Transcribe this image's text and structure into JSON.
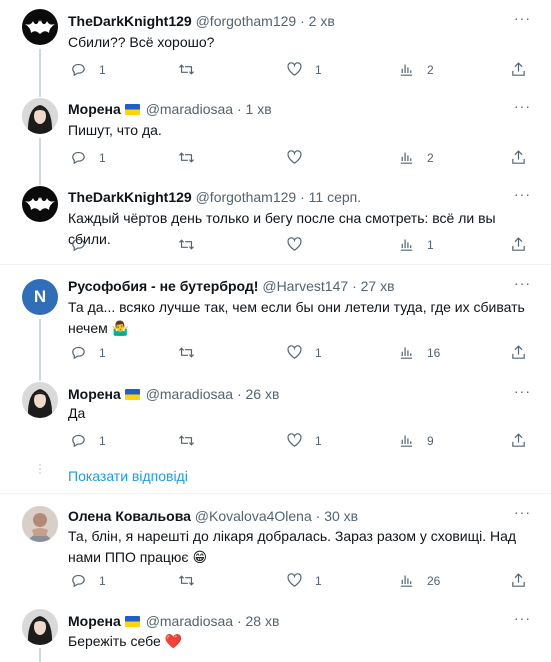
{
  "more_label": "···",
  "show_replies": "Показати відповіді",
  "tweets": [
    {
      "name": "TheDarkKnight129",
      "handle": "@forgotham129",
      "time": "2 хв",
      "text": "Сбили?? Всё хорошо?",
      "replies": "1",
      "retweets": "",
      "likes": "1",
      "views": "2"
    },
    {
      "name": "Морена",
      "handle": "@maradiosaa",
      "time": "1 хв",
      "text": "Пишут, что да.",
      "replies": "1",
      "retweets": "",
      "likes": "",
      "views": "2"
    },
    {
      "name": "TheDarkKnight129",
      "handle": "@forgotham129",
      "time": "11 серп.",
      "text": "Каждый чёртов день только и бегу после сна смотреть: всё ли вы сбили.",
      "replies": "",
      "retweets": "",
      "likes": "",
      "views": "1"
    },
    {
      "name": "Русофобия - не бутерброд!",
      "handle": "@Harvest147",
      "time": "27 хв",
      "text": "Та да... всяко лучше так, чем если бы они летели туда, где их сбивать нечем 🤷‍♂️",
      "replies": "1",
      "retweets": "",
      "likes": "1",
      "views": "16",
      "avatar_letter": "N"
    },
    {
      "name": "Морена",
      "handle": "@maradiosaa",
      "time": "26 хв",
      "text": "Да",
      "replies": "1",
      "retweets": "",
      "likes": "1",
      "views": "9"
    },
    {
      "name": "Олена Ковальова",
      "handle": "@Kovalova4Olena",
      "time": "30 хв",
      "text": "Та, блін, я нарешті до лікаря добралась. Зараз разом у сховищі. Над нами ППО працює 😁",
      "replies": "1",
      "retweets": "",
      "likes": "1",
      "views": "26"
    },
    {
      "name": "Морена",
      "handle": "@maradiosaa",
      "time": "28 хв",
      "text": "Бережіть себе ❤️",
      "replies": "",
      "retweets": "",
      "likes": "",
      "views": ""
    }
  ],
  "colors": {
    "accent": "#1d9bf0",
    "muted": "#536471",
    "border": "#eff3f4",
    "flag_blue": "#1f5fc6",
    "flag_yellow": "#ffd400"
  }
}
